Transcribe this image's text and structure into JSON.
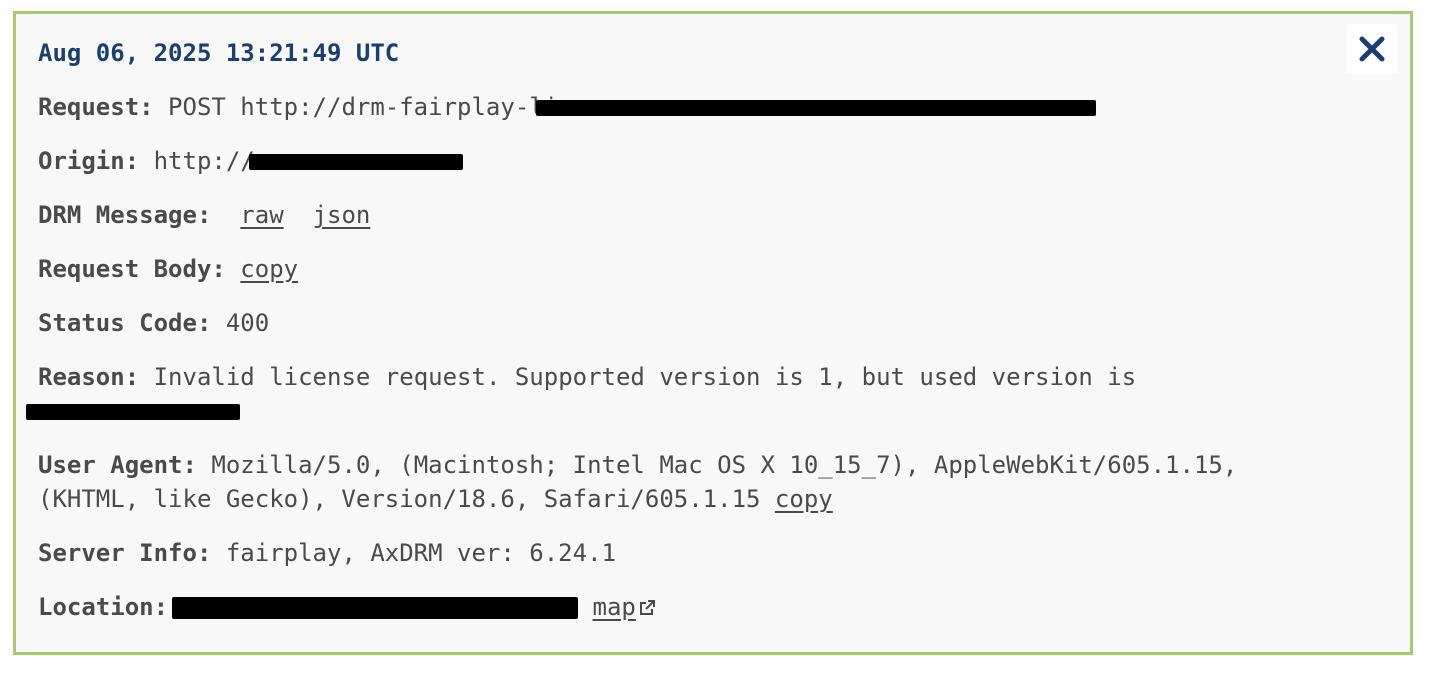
{
  "panel": {
    "timestamp": "Aug 06, 2025 13:21:49 UTC",
    "close_icon": "close-x-icon"
  },
  "fields": {
    "request": {
      "label": "Request:",
      "value": "POST http://drm-fairplay-li"
    },
    "origin": {
      "label": "Origin:",
      "value": "http://"
    },
    "drm_message": {
      "label": "DRM Message:",
      "links": [
        "raw",
        "json"
      ]
    },
    "request_body": {
      "label": "Request Body:",
      "link": "copy"
    },
    "status_code": {
      "label": "Status Code:",
      "value": "400"
    },
    "reason": {
      "label": "Reason:",
      "value": "Invalid license request. Supported version is 1, but used version is"
    },
    "user_agent": {
      "label": "User Agent:",
      "value": "Mozilla/5.0, (Macintosh; Intel Mac OS X 10_15_7), AppleWebKit/605.1.15, (KHTML, like Gecko), Version/18.6, Safari/605.1.15",
      "link": "copy"
    },
    "server_info": {
      "label": "Server Info:",
      "value": "fairplay, AxDRM ver: 6.24.1"
    },
    "location": {
      "label": "Location:",
      "link": "map",
      "link_icon": "external-link-icon"
    }
  },
  "colors": {
    "border": "#a9c96c",
    "timestamp": "#1b3f72",
    "text": "#4a4a4a"
  }
}
